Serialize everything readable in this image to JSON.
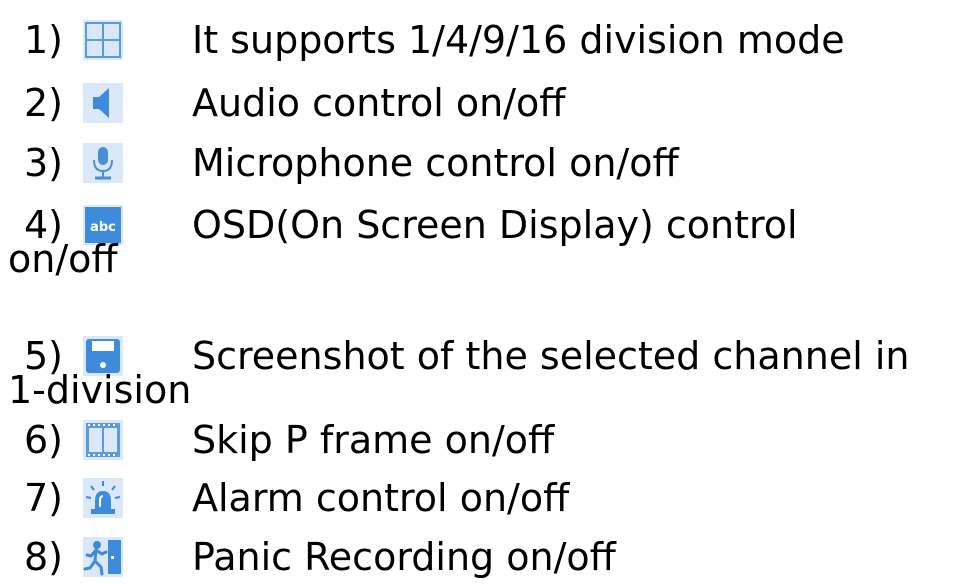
{
  "items": [
    {
      "number": "1)",
      "icon": "grid-four-split-icon",
      "text": "It supports 1/4/9/16 division mode"
    },
    {
      "number": "2)",
      "icon": "speaker-icon",
      "text": "Audio control on/off"
    },
    {
      "number": "3)",
      "icon": "microphone-icon",
      "text": "Microphone control on/off"
    },
    {
      "number": "4)",
      "icon": "abc-osd-icon",
      "text": "OSD(On Screen Display) control",
      "continuation": "on/off"
    },
    {
      "number": "5)",
      "icon": "floppy-disk-icon",
      "text": "Screenshot of the selected channel in",
      "continuation": "1-division"
    },
    {
      "number": "6)",
      "icon": "film-frame-icon",
      "text": "Skip P frame on/off"
    },
    {
      "number": "7)",
      "icon": "alarm-siren-icon",
      "text": "Alarm control on/off"
    },
    {
      "number": "8)",
      "icon": "panic-exit-icon",
      "text": "Panic Recording on/off"
    }
  ],
  "colors": {
    "icon_bg": "#dbe8f7",
    "icon_blue": "#4a90d9",
    "text": "#000000"
  }
}
